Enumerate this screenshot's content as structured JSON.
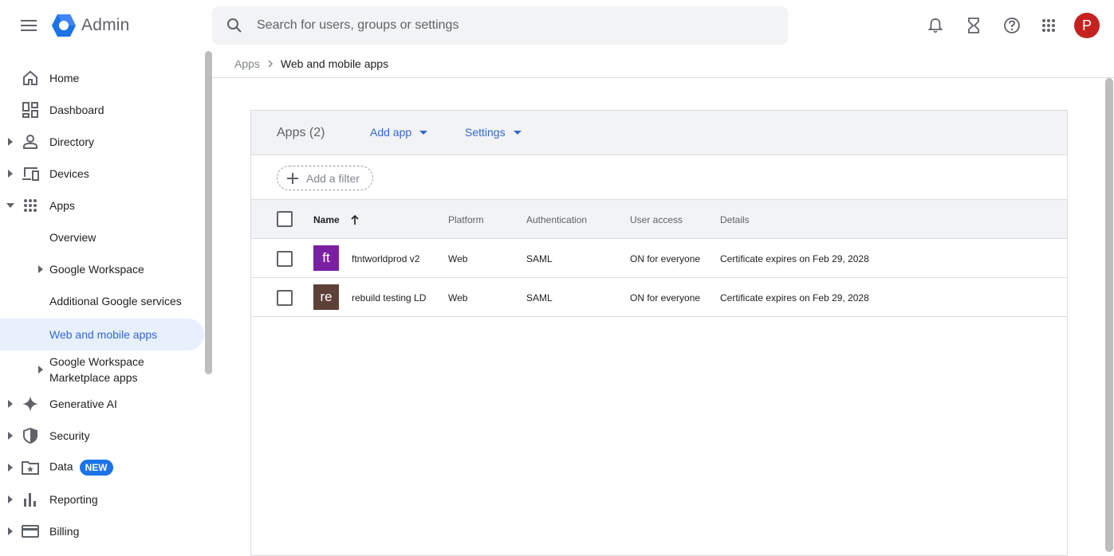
{
  "app": {
    "title": "Admin"
  },
  "search": {
    "placeholder": "Search for users, groups or settings"
  },
  "top_icons": [
    "bell-icon",
    "hourglass-icon",
    "help-icon",
    "apps-grid-icon"
  ],
  "user": {
    "avatar_letter": "P",
    "avatar_color": "#c5221f"
  },
  "sidebar": {
    "items": [
      {
        "label": "Home",
        "icon": "home-icon"
      },
      {
        "label": "Dashboard",
        "icon": "dashboard-icon"
      },
      {
        "label": "Directory",
        "icon": "person-icon"
      },
      {
        "label": "Devices",
        "icon": "devices-icon"
      },
      {
        "label": "Apps",
        "icon": "apps-icon"
      },
      {
        "label": "Overview"
      },
      {
        "label": "Google Workspace"
      },
      {
        "label": "Additional Google services"
      },
      {
        "label": "Web and mobile apps"
      },
      {
        "label": "Google Workspace\nMarketplace apps"
      },
      {
        "label": "Generative AI",
        "icon": "sparkle-icon"
      },
      {
        "label": "Security",
        "icon": "shield-icon"
      },
      {
        "label": "Data",
        "icon": "folder-star-icon",
        "badge": "NEW"
      },
      {
        "label": "Reporting",
        "icon": "bar-chart-icon"
      },
      {
        "label": "Billing",
        "icon": "credit-card-icon"
      }
    ]
  },
  "breadcrumb": {
    "parent": "Apps",
    "current": "Web and mobile apps"
  },
  "card": {
    "title": "Apps (2)",
    "add_app": "Add app",
    "settings": "Settings",
    "filter": "Add a filter"
  },
  "table": {
    "columns": [
      "Name",
      "Platform",
      "Authentication",
      "User access",
      "Details"
    ],
    "rows": [
      {
        "initials": "ft",
        "tile_color": "#7b1fa2",
        "name": "ftntworldprod v2",
        "platform": "Web",
        "auth": "SAML",
        "access": "ON for everyone",
        "details": "Certificate expires on Feb 29, 2028"
      },
      {
        "initials": "re",
        "tile_color": "#5d4037",
        "name": "rebuild testing LD",
        "platform": "Web",
        "auth": "SAML",
        "access": "ON for everyone",
        "details": "Certificate expires on Feb 29, 2028"
      }
    ]
  }
}
